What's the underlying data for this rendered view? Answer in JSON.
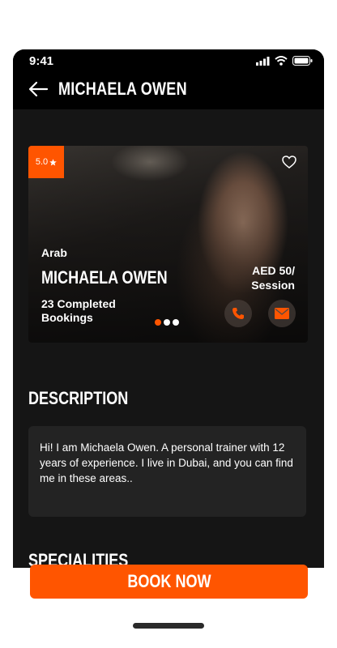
{
  "status": {
    "time": "9:41"
  },
  "header": {
    "title": "MICHAELA OWEN"
  },
  "trainer": {
    "rating": "5.0",
    "origin": "Arab",
    "name": "MICHAELA OWEN",
    "bookings": "23 Completed Bookings",
    "price": "AED 50/ Session",
    "carousel_active_index": 0,
    "carousel_count": 3
  },
  "description": {
    "heading": "DESCRIPTION",
    "text": "Hi! I am Michaela Owen. A personal trainer with 12 years of experience. I live in Dubai, and you can find me in these areas.."
  },
  "specialities": {
    "heading": "SPECIALITIES"
  },
  "actions": {
    "book_label": "BOOK NOW"
  },
  "colors": {
    "accent": "#ff5500",
    "background": "#151515",
    "surface": "#232323"
  },
  "icons": [
    "back-arrow-icon",
    "heart-icon",
    "star-icon",
    "phone-icon",
    "mail-icon",
    "signal-icon",
    "wifi-icon",
    "battery-icon"
  ]
}
